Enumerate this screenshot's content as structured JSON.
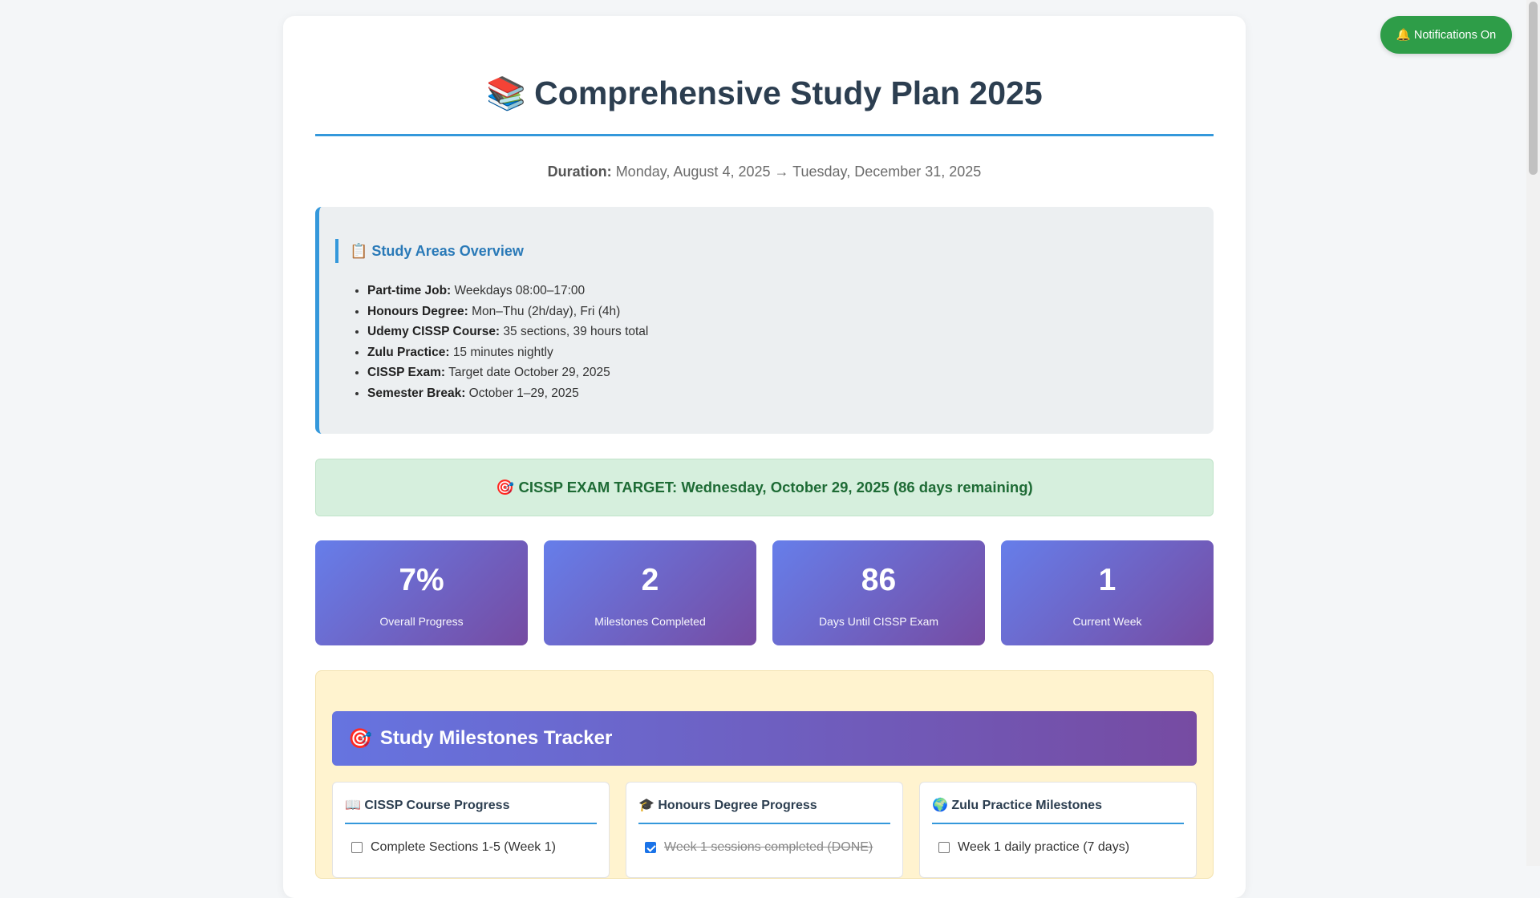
{
  "title": {
    "emoji": "📚",
    "text": "Comprehensive Study Plan 2025"
  },
  "duration": {
    "label": "Duration:",
    "value": "Monday, August 4, 2025 → Tuesday, December 31, 2025"
  },
  "overview": {
    "heading": "📋 Study Areas Overview",
    "items": [
      {
        "label": "Part-time Job:",
        "value": "Weekdays 08:00–17:00"
      },
      {
        "label": "Honours Degree:",
        "value": "Mon–Thu (2h/day), Fri (4h)"
      },
      {
        "label": "Udemy CISSP Course:",
        "value": "35 sections, 39 hours total"
      },
      {
        "label": "Zulu Practice:",
        "value": "15 minutes nightly"
      },
      {
        "label": "CISSP Exam:",
        "value": "Target date October 29, 2025"
      },
      {
        "label": "Semester Break:",
        "value": "October 1–29, 2025"
      }
    ]
  },
  "target": {
    "text": "🎯 CISSP EXAM TARGET: Wednesday, October 29, 2025 (86 days remaining)"
  },
  "stats": [
    {
      "value": "7%",
      "label": "Overall Progress"
    },
    {
      "value": "2",
      "label": "Milestones Completed"
    },
    {
      "value": "86",
      "label": "Days Until CISSP Exam"
    },
    {
      "value": "1",
      "label": "Current Week"
    }
  ],
  "milestones": {
    "header_emoji": "🎯",
    "header": "Study Milestones Tracker",
    "columns": [
      {
        "title": "📖 CISSP Course Progress",
        "items": [
          {
            "text": "Complete Sections 1-5 (Week 1)",
            "checked": false
          }
        ]
      },
      {
        "title": "🎓 Honours Degree Progress",
        "items": [
          {
            "text": "Week 1 sessions completed (DONE)",
            "checked": true
          }
        ]
      },
      {
        "title": "🌍 Zulu Practice Milestones",
        "items": [
          {
            "text": "Week 1 daily practice (7 days)",
            "checked": false
          }
        ]
      }
    ]
  },
  "notification_button": {
    "text": "🔔 Notifications On",
    "color": "#2e9d48"
  },
  "colors": {
    "accent": "#3498db",
    "stat_gradient_start": "#667eea",
    "stat_gradient_end": "#764ba2",
    "target_text": "#1e6b35"
  }
}
